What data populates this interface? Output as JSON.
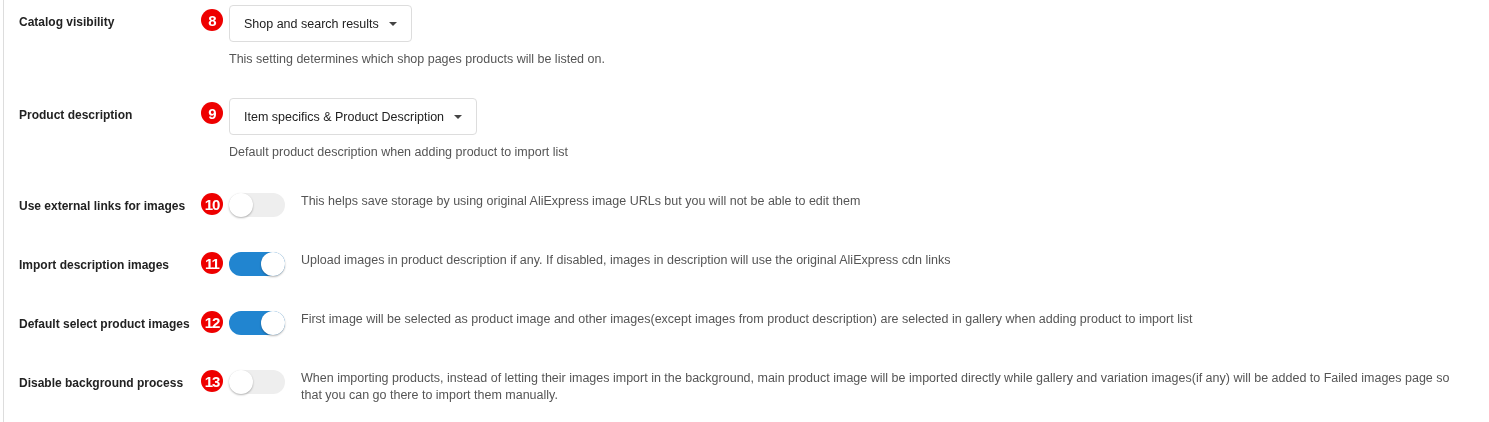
{
  "settings": [
    {
      "kind": "dropdown",
      "label": "Catalog visibility",
      "badge": "8",
      "value": "Shop and search results",
      "help": "This setting determines which shop pages products will be listed on."
    },
    {
      "kind": "dropdown",
      "label": "Product description",
      "badge": "9",
      "value": "Item specifics & Product Description",
      "help": "Default product description when adding product to import list"
    },
    {
      "kind": "toggle",
      "label": "Use external links for images",
      "badge": "10",
      "on": false,
      "help": "This helps save storage by using original AliExpress image URLs but you will not be able to edit them"
    },
    {
      "kind": "toggle",
      "label": "Import description images",
      "badge": "11",
      "on": true,
      "help": "Upload images in product description if any. If disabled, images in description will use the original AliExpress cdn links"
    },
    {
      "kind": "toggle",
      "label": "Default select product images",
      "badge": "12",
      "on": true,
      "help": "First image will be selected as product image and other images(except images from product description) are selected in gallery when adding product to import list"
    },
    {
      "kind": "toggle",
      "label": "Disable background process",
      "badge": "13",
      "on": false,
      "help": "When importing products, instead of letting their images import in the background, main product image will be imported directly while gallery and variation images(if any) will be added to Failed images page so that you can go there to import them manually."
    }
  ]
}
